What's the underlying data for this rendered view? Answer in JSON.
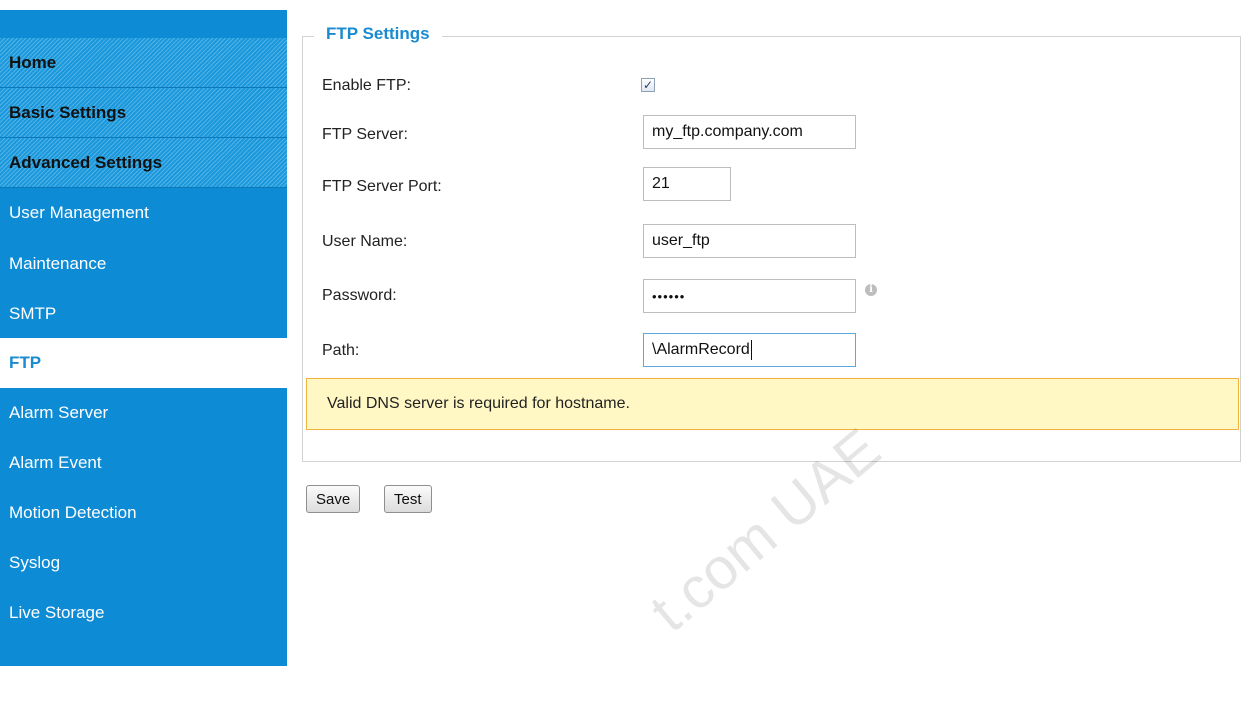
{
  "sidebar": {
    "items": [
      {
        "label": "Home"
      },
      {
        "label": "Basic Settings"
      },
      {
        "label": "Advanced Settings"
      },
      {
        "label": "User Management"
      },
      {
        "label": "Maintenance"
      },
      {
        "label": "SMTP"
      },
      {
        "label": "FTP"
      },
      {
        "label": "Alarm Server"
      },
      {
        "label": "Alarm Event"
      },
      {
        "label": "Motion Detection"
      },
      {
        "label": "Syslog"
      },
      {
        "label": "Live Storage"
      }
    ]
  },
  "ftp": {
    "legend": "FTP Settings",
    "enable_label": "Enable FTP:",
    "enable_checked": true,
    "server_label": "FTP Server:",
    "server_value": "my_ftp.company.com",
    "port_label": "FTP Server Port:",
    "port_value": "21",
    "user_label": "User Name:",
    "user_value": "user_ftp",
    "password_label": "Password:",
    "password_value": "••••••",
    "path_label": "Path:",
    "path_value": "\\AlarmRecord",
    "warning": "Valid DNS server is required for hostname."
  },
  "buttons": {
    "save": "Save",
    "test": "Test"
  },
  "watermark": "t.com UAE",
  "colors": {
    "sidebar_bg": "#0e8bd5",
    "accent": "#1a8bd0",
    "warning_bg": "#fff8c4",
    "warning_border": "#f2b33d"
  }
}
